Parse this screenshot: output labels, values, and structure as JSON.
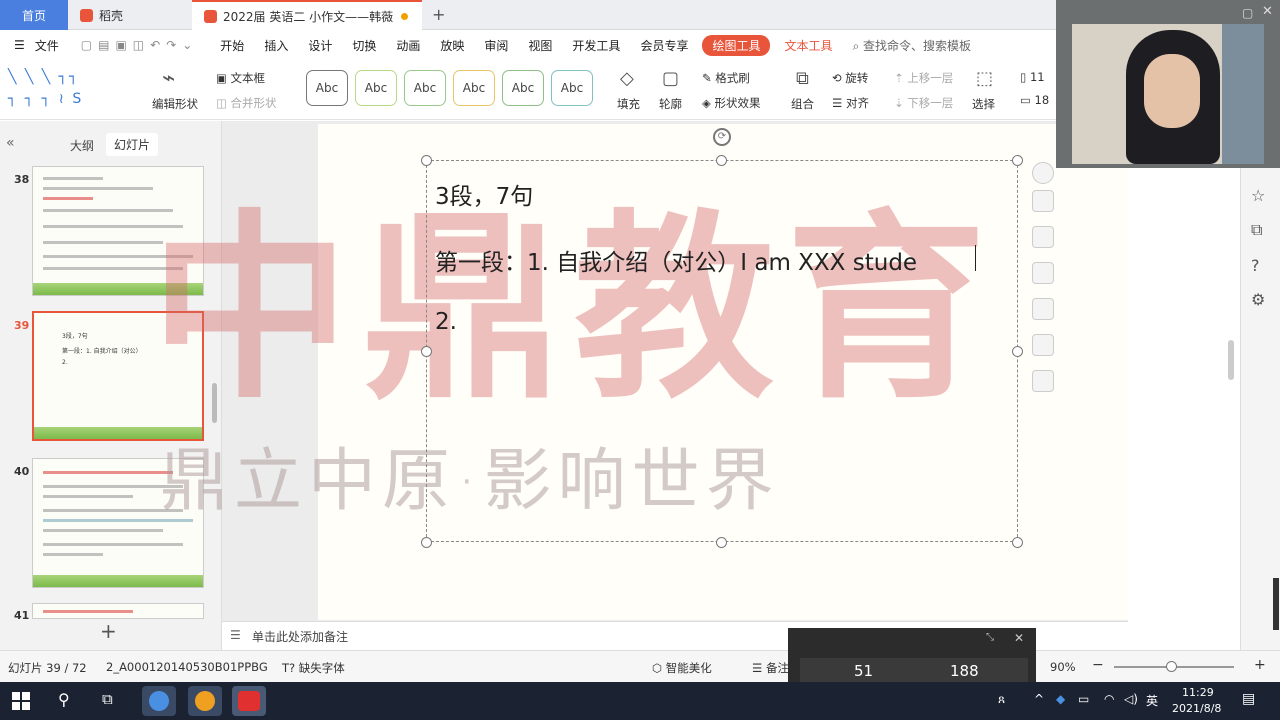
{
  "tabs": {
    "home": "首页",
    "daoke": "稻壳",
    "doc": "2022届 英语二 小作文——韩薇",
    "add": "+"
  },
  "menu": {
    "file": "文件",
    "items": [
      "开始",
      "插入",
      "设计",
      "切换",
      "动画",
      "放映",
      "审阅",
      "视图",
      "开发工具",
      "会员专享"
    ],
    "draw_tool": "绘图工具",
    "text_tool": "文本工具",
    "search": "查找命令、搜索模板"
  },
  "ribbon": {
    "edit_shape": "编辑形状",
    "textbox": "文本框",
    "merge_shape": "合并形状",
    "style_sample": "Abc",
    "fill": "填充",
    "outline": "轮廓",
    "format_painter": "格式刷",
    "shape_effect": "形状效果",
    "group": "组合",
    "rotate": "旋转",
    "align": "对齐",
    "bring_forward": "上移一层",
    "send_backward": "下移一层",
    "select": "选择",
    "size_w": "11",
    "size_h": "18"
  },
  "left_panel": {
    "outline_tab": "大纲",
    "slides_tab": "幻灯片",
    "slides": [
      {
        "num": "38"
      },
      {
        "num": "39",
        "line1": "3段，7句",
        "line2": "第一段：1. 自我介绍（对公）",
        "line3": "2."
      },
      {
        "num": "40"
      },
      {
        "num": "41"
      }
    ],
    "add": "+"
  },
  "slide": {
    "line1": "3段，7句",
    "line2": "第一段：1. 自我介绍（对公）I am XXX stude",
    "line3": "2."
  },
  "watermark": {
    "main": "中鼎教育",
    "slogan": "鼎立中原·影响世界"
  },
  "notes_placeholder": "单击此处添加备注",
  "status": {
    "slide_info": "幻灯片 39 / 72",
    "template": "2_A000120140530B01PPBG",
    "missing_font": "缺失字体",
    "beautify": "智能美化",
    "notes_short": "备注",
    "zoom": "90%"
  },
  "overlay": {
    "left_value": "51",
    "right_value": "188"
  },
  "taskbar": {
    "ime": "英",
    "time": "11:29",
    "date": "2021/8/8"
  },
  "colors": {
    "accent": "#e8553b",
    "home_tab": "#4a7fe0",
    "watermark": "#d66c6c"
  }
}
